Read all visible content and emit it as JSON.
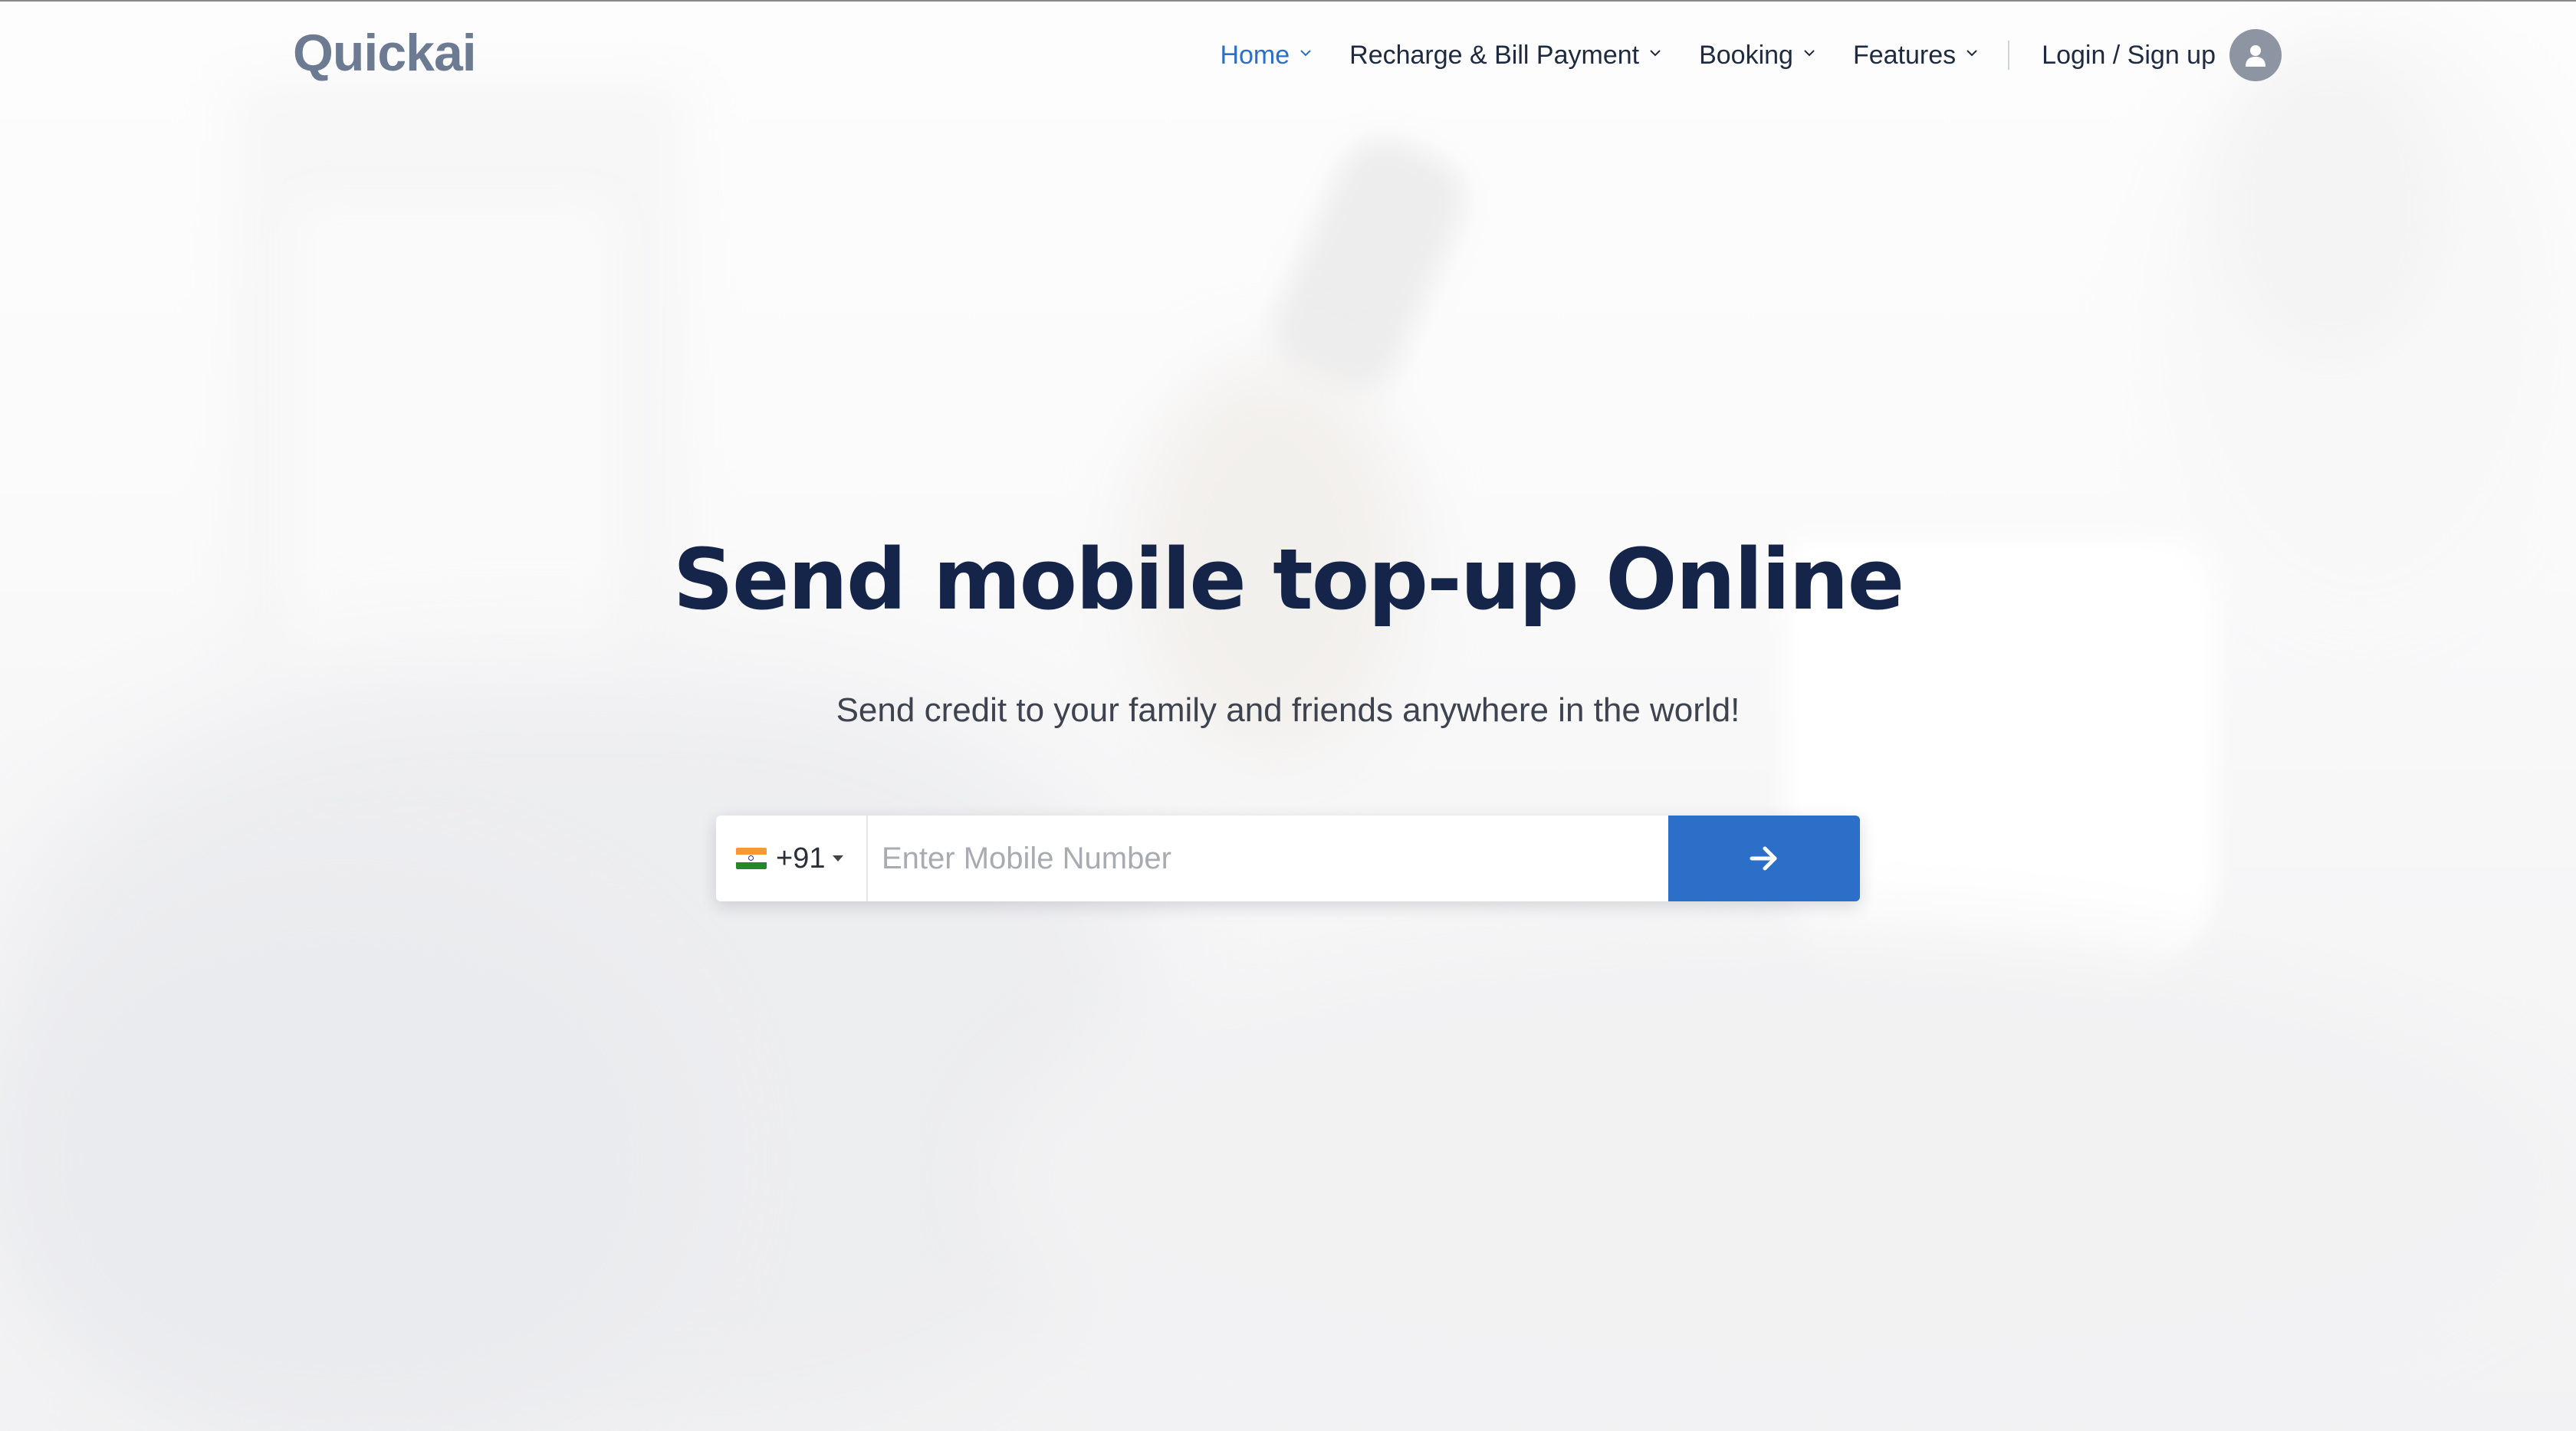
{
  "brand": {
    "logo_text": "Quickai"
  },
  "nav": {
    "items": [
      {
        "label": "Home",
        "active": true
      },
      {
        "label": "Recharge & Bill Payment",
        "active": false
      },
      {
        "label": "Booking",
        "active": false
      },
      {
        "label": "Features",
        "active": false
      }
    ],
    "login_label": "Login / Sign up"
  },
  "hero": {
    "title": "Send mobile top-up Online",
    "subtitle": "Send credit to your family and friends anywhere in the world!"
  },
  "form": {
    "country_code": "+91",
    "country_flag": "india-flag-icon",
    "phone_placeholder": "Enter Mobile Number",
    "phone_value": "",
    "submit_icon": "arrow-right-icon"
  },
  "colors": {
    "accent": "#2b6fc8",
    "title": "#15254a",
    "logo": "#6d7b92",
    "nav_active": "#2a6fc9"
  }
}
